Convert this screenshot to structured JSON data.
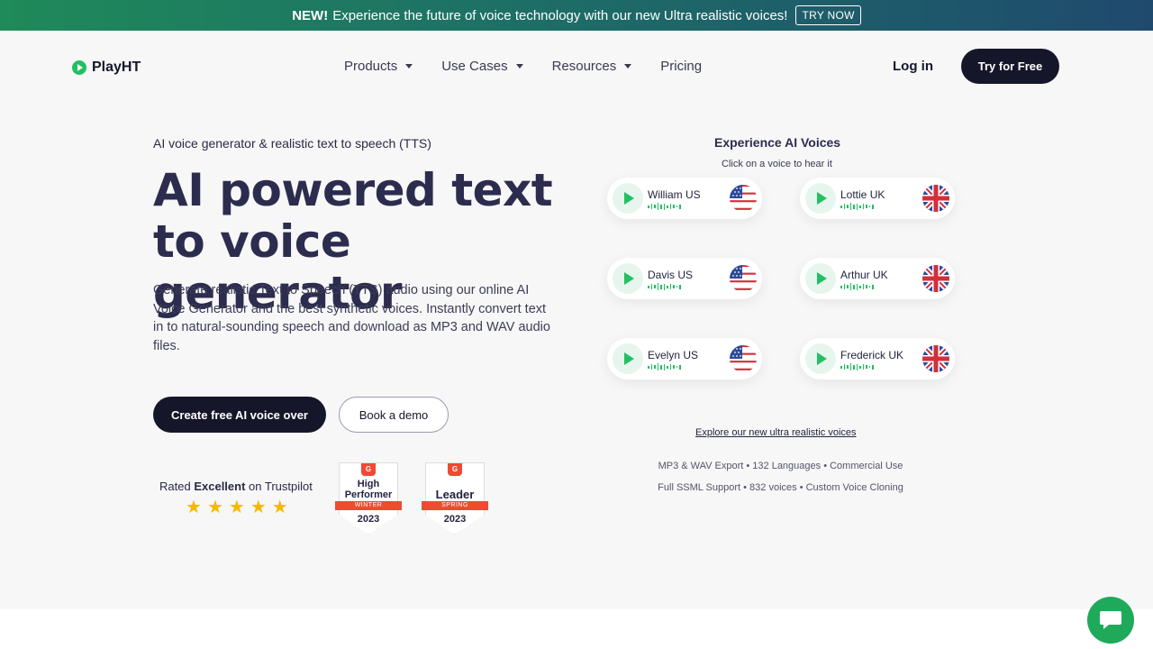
{
  "banner": {
    "new_label": "NEW!",
    "text": "Experience the future of voice technology with our new Ultra realistic voices!",
    "cta": "TRY NOW"
  },
  "nav": {
    "logo": "PlayHT",
    "items": [
      "Products",
      "Use Cases",
      "Resources",
      "Pricing"
    ],
    "login": "Log in",
    "cta": "Try for Free"
  },
  "hero": {
    "eyebrow": "AI voice generator & realistic text to speech (TTS)",
    "headline": "AI powered text to voice generator",
    "description": "Generate realistic Text to Speech (TTS) audio using our online AI Voice Generator and the best synthetic voices. Instantly convert text in to natural-sounding speech and download as MP3 and WAV audio files.",
    "primary_cta": "Create free AI voice over",
    "secondary_cta": "Book a demo"
  },
  "trust": {
    "rated_prefix": "Rated",
    "rated_bold": "Excellent",
    "rated_suffix": "on Trustpilot",
    "star_count": 5,
    "badges": [
      {
        "title": "High Performer",
        "ribbon": "WINTER",
        "year": "2023"
      },
      {
        "title": "Leader",
        "ribbon": "SPRING",
        "year": "2023"
      }
    ]
  },
  "voices": {
    "title": "Experience AI Voices",
    "subtitle": "Click on a voice to hear it",
    "list": [
      {
        "name": "William US",
        "flag": "us-flag-icon"
      },
      {
        "name": "Lottie UK",
        "flag": "uk-flag-icon"
      },
      {
        "name": "Davis US",
        "flag": "us-flag-icon"
      },
      {
        "name": "Arthur UK",
        "flag": "uk-flag-icon"
      },
      {
        "name": "Evelyn US",
        "flag": "us-flag-icon"
      },
      {
        "name": "Frederick UK",
        "flag": "uk-flag-icon"
      }
    ],
    "explore_link": "Explore our new ultra realistic voices",
    "features_line1": "MP3 & WAV Export  •  132 Languages  •  Commercial Use",
    "features_line2": "Full SSML Support  •  832 voices  •  Custom Voice Cloning"
  },
  "colors": {
    "accent_green": "#21c063",
    "dark": "#16162a",
    "heading": "#2c2c4e"
  }
}
